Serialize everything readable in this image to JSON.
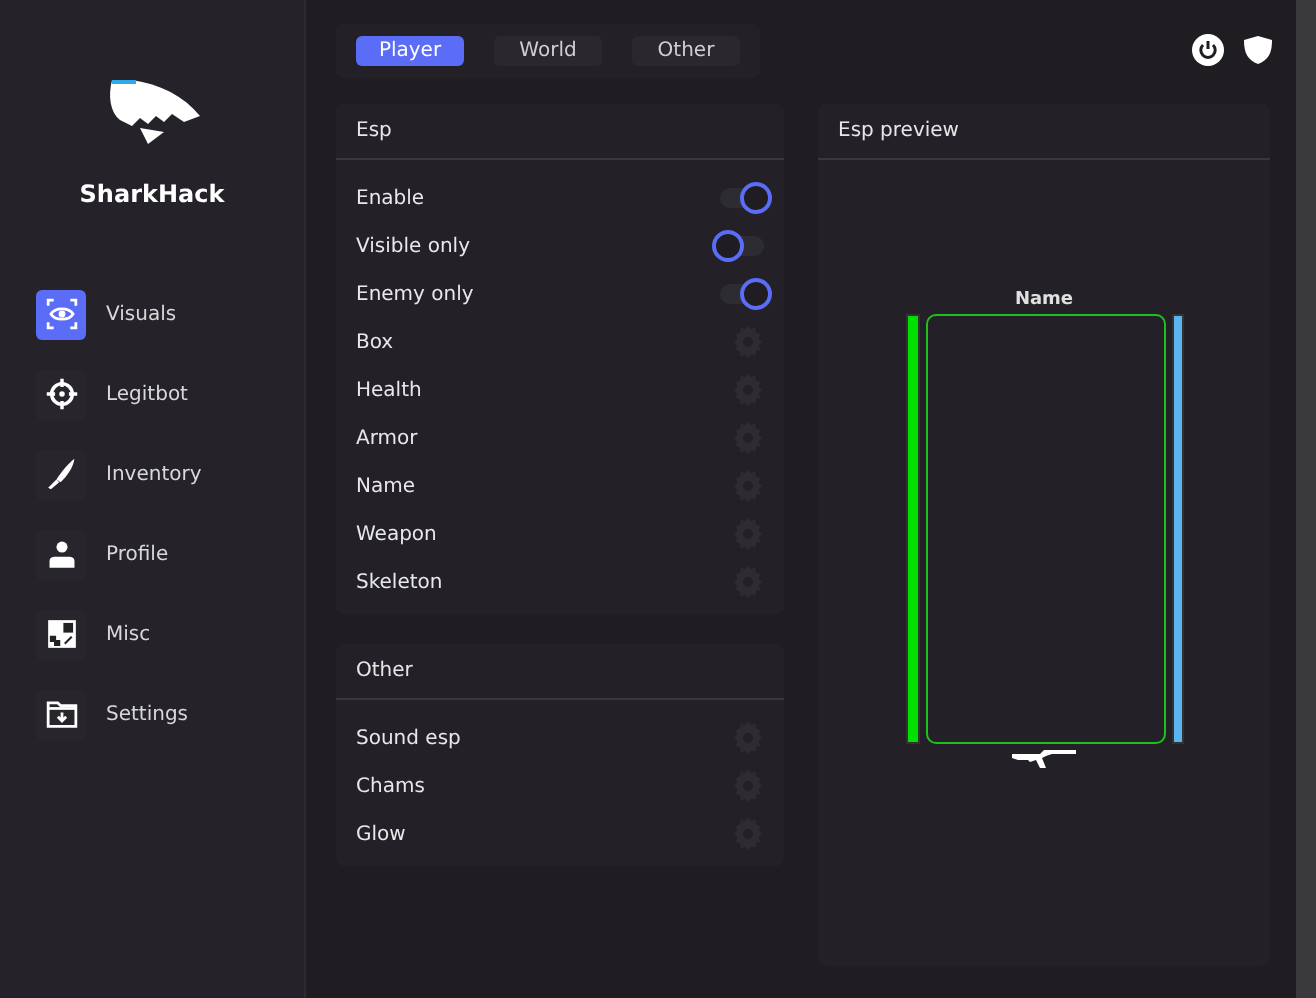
{
  "brand": {
    "name": "SharkHack"
  },
  "nav": [
    {
      "label": "Visuals",
      "kind": "eye",
      "selected": true
    },
    {
      "label": "Legitbot",
      "kind": "crosshair",
      "selected": false
    },
    {
      "label": "Inventory",
      "kind": "knife",
      "selected": false
    },
    {
      "label": "Profile",
      "kind": "person",
      "selected": false
    },
    {
      "label": "Misc",
      "kind": "grid",
      "selected": false
    },
    {
      "label": "Settings",
      "kind": "folder",
      "selected": false
    }
  ],
  "tabs": [
    {
      "label": "Player",
      "selected": true
    },
    {
      "label": "World",
      "selected": false
    },
    {
      "label": "Other",
      "selected": false
    }
  ],
  "panels": [
    {
      "title": "Esp",
      "items": [
        {
          "label": "Enable",
          "kind": "toggle",
          "on": true
        },
        {
          "label": "Visible only",
          "kind": "toggle",
          "on": false
        },
        {
          "label": "Enemy only",
          "kind": "toggle",
          "on": true
        },
        {
          "label": "Box",
          "kind": "settings"
        },
        {
          "label": "Health",
          "kind": "settings"
        },
        {
          "label": "Armor",
          "kind": "settings"
        },
        {
          "label": "Name",
          "kind": "settings"
        },
        {
          "label": "Weapon",
          "kind": "settings"
        },
        {
          "label": "Skeleton",
          "kind": "settings"
        }
      ]
    },
    {
      "title": "Other",
      "items": [
        {
          "label": "Sound esp",
          "kind": "settings"
        },
        {
          "label": "Chams",
          "kind": "settings"
        },
        {
          "label": "Glow",
          "kind": "settings"
        }
      ]
    }
  ],
  "preview": {
    "title": "Esp preview",
    "name_tag": "Name"
  }
}
